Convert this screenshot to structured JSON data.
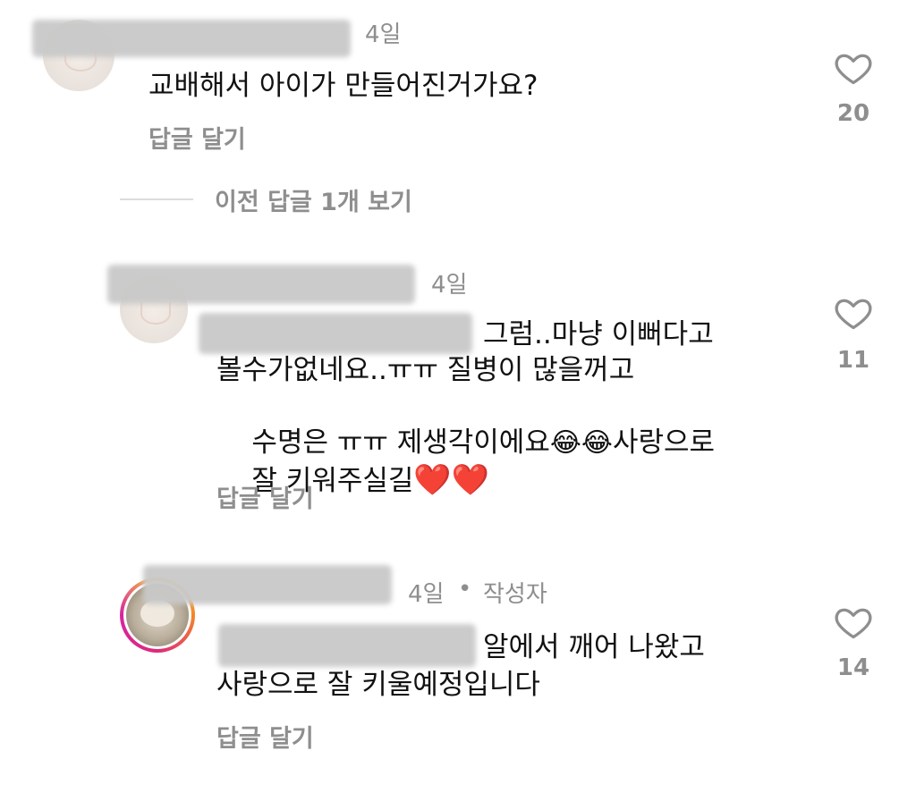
{
  "comments": [
    {
      "time": "4일",
      "text": "교배해서 아이가 만들어진거가요?",
      "reply_label": "답글 달기",
      "likes": "20"
    }
  ],
  "view_previous": "이전 답글 1개 보기",
  "replies": [
    {
      "time": "4일",
      "text_line1": "그럼..마냥 이뻐다고",
      "text_line2": "볼수가없네요..ㅠㅠ 질병이 많을꺼고",
      "text_line3a": "수명은 ㅠㅠ 제생각이에요",
      "emoji_a": "😂😂",
      "text_line3b": "사랑으로",
      "text_line4": "잘 키워주실길",
      "hearts": "❤️❤️",
      "reply_label": "답글 달기",
      "likes": "11"
    },
    {
      "time": "4일",
      "dot": "•",
      "author_badge": "작성자",
      "text_line1": "알에서 깨어 나왔고",
      "text_line2": "사랑으로 잘 키울예정입니다",
      "reply_label": "답글 달기",
      "likes": "14"
    }
  ],
  "icons": {
    "like": "heart-outline-icon"
  },
  "colors": {
    "meta": "#8e8e8e",
    "mention": "#2a4bbf",
    "story_ring_start": "#f9c83a",
    "story_ring_end": "#d6249f"
  }
}
